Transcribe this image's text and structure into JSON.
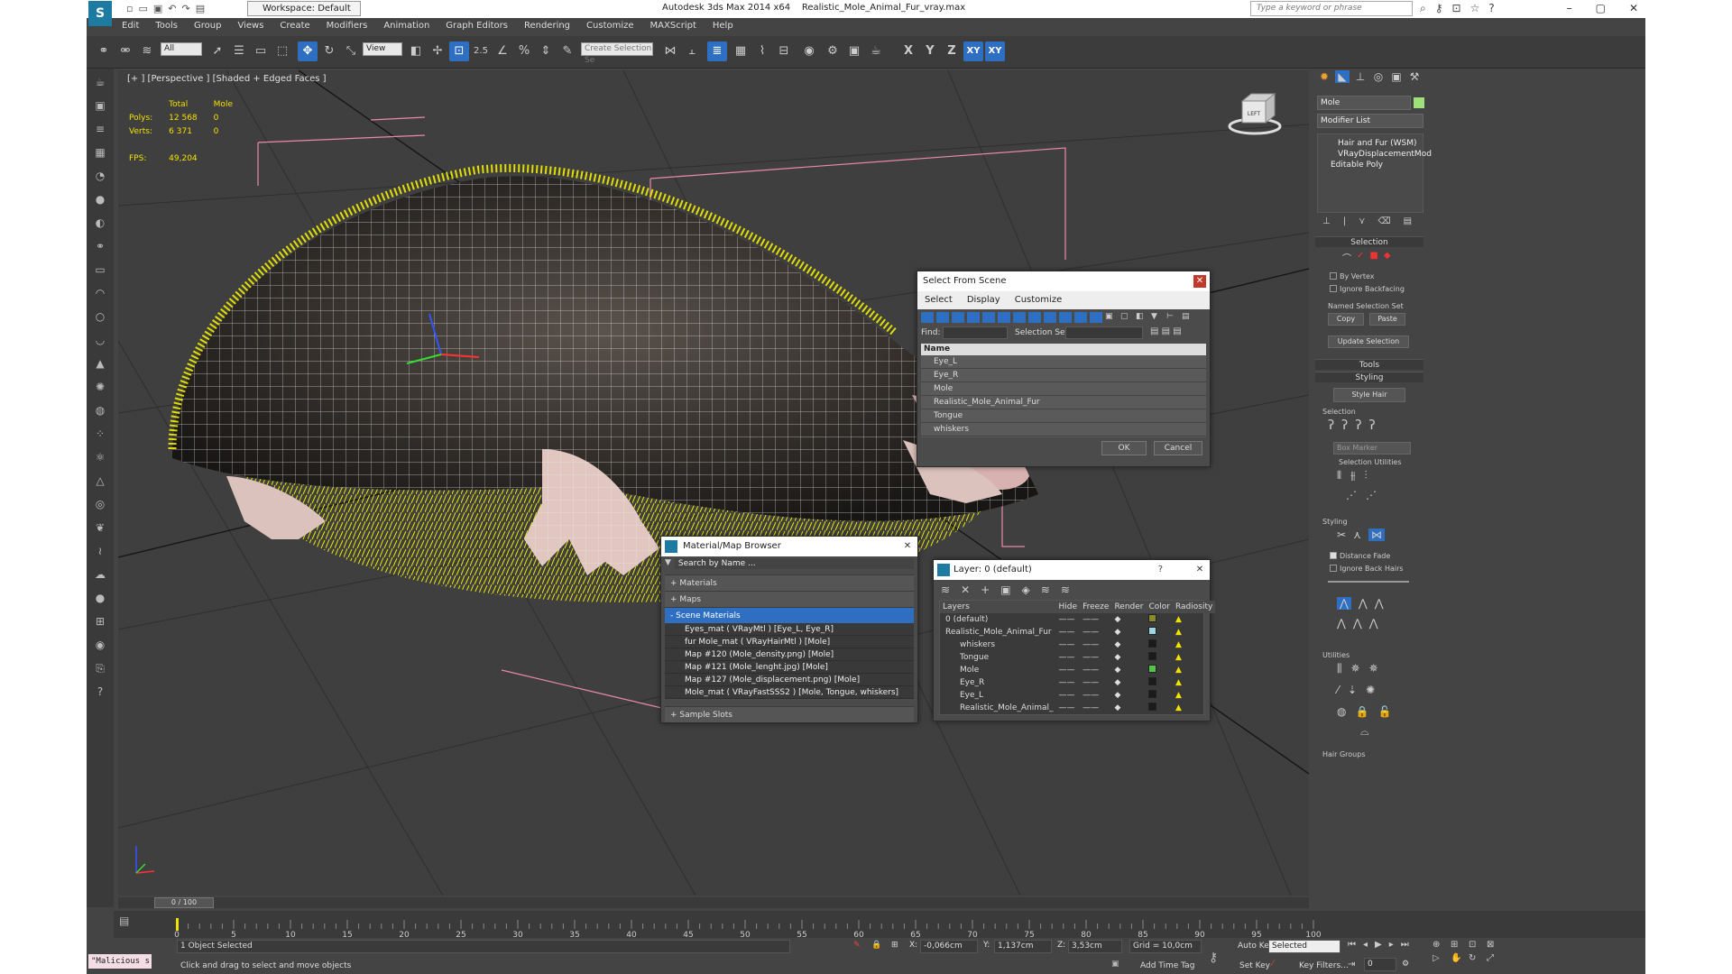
{
  "title": {
    "workspace": "Workspace: Default",
    "app": "Autodesk 3ds Max  2014 x64",
    "file": "Realistic_Mole_Animal_Fur_vray.max",
    "search_placeholder": "Type a keyword or phrase"
  },
  "menu": [
    "Edit",
    "Tools",
    "Group",
    "Views",
    "Create",
    "Modifiers",
    "Animation",
    "Graph Editors",
    "Rendering",
    "Customize",
    "MAXScript",
    "Help"
  ],
  "toolbar": {
    "filter": "All",
    "refcoord": "View",
    "snap_label": "2.5",
    "selection_set_placeholder": "Create Selection Se",
    "axis": [
      "X",
      "Y",
      "Z",
      "XY",
      "XY"
    ]
  },
  "viewport": {
    "label": "[+ ] [Perspective ] [Shaded + Edged Faces ]",
    "stats": {
      "col_total": "Total",
      "col_obj": "Mole",
      "polys_label": "Polys:",
      "polys_total": "12 568",
      "polys_obj": "0",
      "verts_label": "Verts:",
      "verts_total": "6 371",
      "verts_obj": "0",
      "fps_label": "FPS:",
      "fps_value": "49,204"
    },
    "cube_label": "LEFT"
  },
  "command_panel": {
    "object_name": "Mole",
    "modifier_list": "Modifier List",
    "stack": [
      "Hair and Fur (WSM)",
      "VRayDisplacementMod",
      "Editable Poly"
    ],
    "selection_head": "Selection",
    "by_vertex": "By Vertex",
    "ignore_backfacing": "Ignore Backfacing",
    "named_selection_sets": "Named Selection Set",
    "copy": "Copy",
    "paste": "Paste",
    "update_selection": "Update Selection",
    "tools_head": "Tools",
    "styling_head": "Styling",
    "style_hair": "Style Hair",
    "selection_sub": "Selection",
    "box_marker": "Box Marker",
    "selection_utilities": "Selection Utilities",
    "styling_sub": "Styling",
    "distance_fade": "Distance Fade",
    "ignore_back_hairs": "Ignore Back Hairs",
    "utilities": "Utilities",
    "hair_groups": "Hair Groups"
  },
  "select_from_scene": {
    "title": "Select From Scene",
    "menus": [
      "Select",
      "Display",
      "Customize"
    ],
    "find_label": "Find:",
    "selection_set_label": "Selection Set:",
    "column": "Name",
    "items": [
      "Eye_L",
      "Eye_R",
      "Mole",
      "Realistic_Mole_Animal_Fur",
      "Tongue",
      "whiskers"
    ],
    "ok": "OK",
    "cancel": "Cancel"
  },
  "material_browser": {
    "title": "Material/Map Browser",
    "search_placeholder": "Search by Name ...",
    "materials": "+ Materials",
    "maps": "+ Maps",
    "scene_materials": "- Scene Materials",
    "scene_items": [
      "Eyes_mat  ( VRayMtl ) [Eye_L, Eye_R]",
      "fur Mole_mat  ( VRayHairMtl ) [Mole]",
      "Map #120 (Mole_density.png) [Mole]",
      "Map #121 (Mole_lenght.jpg) [Mole]",
      "Map #127 (Mole_displacement.png) [Mole]",
      "Mole_mat  ( VRayFastSSS2 ) [Mole, Tongue, whiskers]"
    ],
    "sample_slots": "+ Sample Slots"
  },
  "layer_manager": {
    "title": "Layer: 0 (default)",
    "help": "?",
    "columns": [
      "Layers",
      "Hide",
      "Freeze",
      "Render",
      "Color",
      "Radiosity"
    ],
    "rows": [
      {
        "name": "0 (default)",
        "color": "#8a8a2a"
      },
      {
        "name": "Realistic_Mole_Animal_Fur",
        "color": "#9fd6e6"
      },
      {
        "name": "whiskers",
        "color": "#1b1b1b"
      },
      {
        "name": "Tongue",
        "color": "#1b1b1b"
      },
      {
        "name": "Mole",
        "color": "#59c24a"
      },
      {
        "name": "Eye_R",
        "color": "#1b1b1b"
      },
      {
        "name": "Eye_L",
        "color": "#1b1b1b"
      },
      {
        "name": "Realistic_Mole_Animal_",
        "color": "#1b1b1b"
      }
    ]
  },
  "timeline": {
    "frame": "0 / 100",
    "ticks": [
      "0",
      "5",
      "10",
      "15",
      "20",
      "25",
      "30",
      "35",
      "40",
      "45",
      "50",
      "55",
      "60",
      "65",
      "70",
      "75",
      "80",
      "85",
      "90",
      "95",
      "100"
    ]
  },
  "status": {
    "maxscript": "\"Malicious s",
    "objects": "1 Object Selected",
    "prompt": "Click and drag to select and move objects",
    "x_label": "X:",
    "x": "-0,066cm",
    "y_label": "Y:",
    "y": "1,137cm",
    "z_label": "Z:",
    "z": "3,53cm",
    "grid": "Grid = 10,0cm",
    "auto_key": "Auto Key",
    "selected": "Selected",
    "set_key": "Set Key",
    "key_filters": "Key Filters...",
    "add_time_tag": "Add Time Tag",
    "frame_field": "0"
  },
  "colors": {
    "accent": "#2f6fc2",
    "fur": "#f2f000",
    "bbox": "#e88aa8"
  }
}
